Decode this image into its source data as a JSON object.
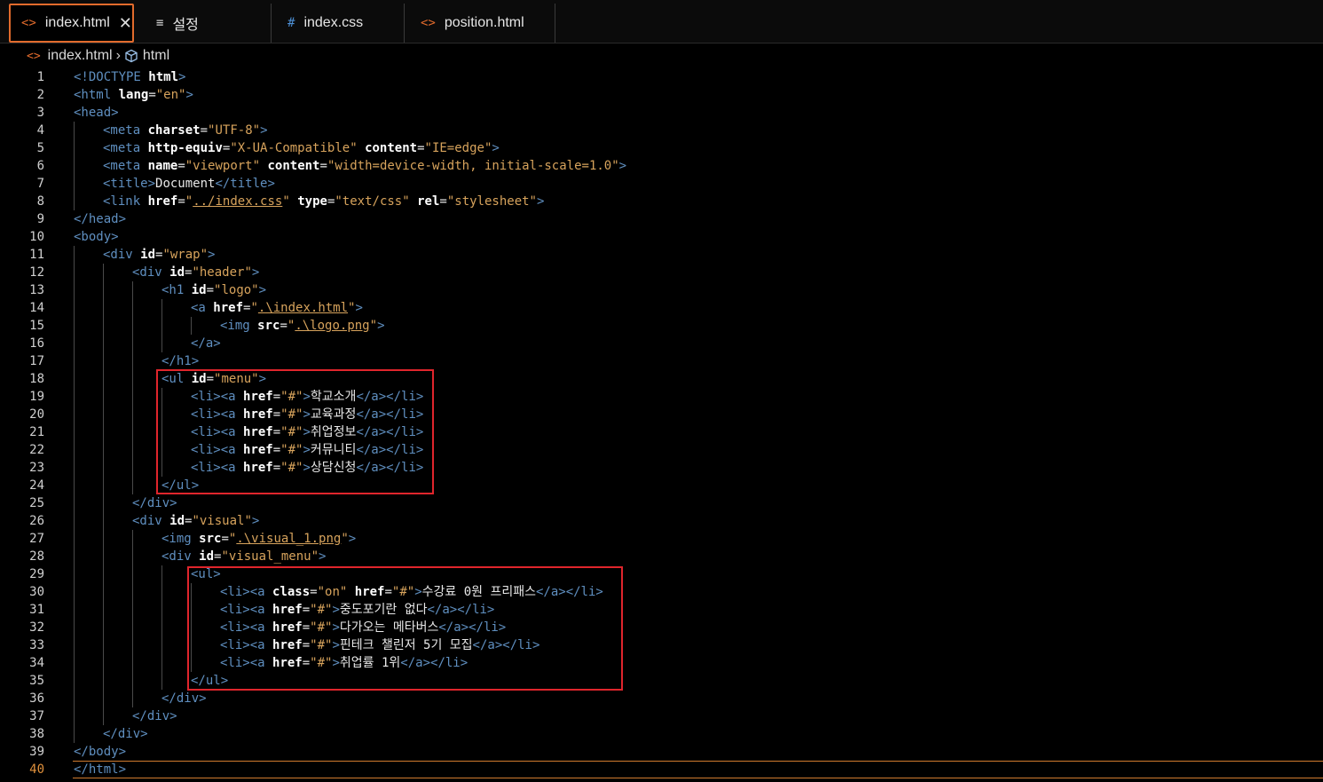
{
  "tabs": [
    {
      "icon": "<>",
      "label": "index.html",
      "active": true
    },
    {
      "icon": "≡",
      "label": "설정"
    },
    {
      "icon": "#",
      "label": "index.css"
    },
    {
      "icon": "<>",
      "label": "position.html"
    }
  ],
  "breadcrumb": {
    "file": "index.html",
    "symbol": "html"
  },
  "colors": {
    "tag": "#5f8fc0",
    "attr": "#ffffff",
    "string": "#d7a35c",
    "accent": "#e26b2c",
    "highlight": "#e0252c"
  },
  "current_line": 40,
  "lines": [
    {
      "n": "1",
      "i": 0,
      "h": "<span class='t'>&lt;!DOCTYPE</span> <span class='a'>html</span><span class='t'>&gt;</span>"
    },
    {
      "n": "2",
      "i": 0,
      "h": "<span class='t'>&lt;html</span> <span class='a'>lang</span><span class='p'>=</span><span class='s'>\"en\"</span><span class='t'>&gt;</span>"
    },
    {
      "n": "3",
      "i": 0,
      "h": "<span class='t'>&lt;head&gt;</span>"
    },
    {
      "n": "4",
      "i": 1,
      "h": "<span class='t'>&lt;meta</span> <span class='a'>charset</span><span class='p'>=</span><span class='s'>\"UTF-8\"</span><span class='t'>&gt;</span>"
    },
    {
      "n": "5",
      "i": 1,
      "h": "<span class='t'>&lt;meta</span> <span class='a'>http-equiv</span><span class='p'>=</span><span class='s'>\"X-UA-Compatible\"</span> <span class='a'>content</span><span class='p'>=</span><span class='s'>\"IE=edge\"</span><span class='t'>&gt;</span>"
    },
    {
      "n": "6",
      "i": 1,
      "h": "<span class='t'>&lt;meta</span> <span class='a'>name</span><span class='p'>=</span><span class='s'>\"viewport\"</span> <span class='a'>content</span><span class='p'>=</span><span class='s'>\"width=device-width, initial-scale=1.0\"</span><span class='t'>&gt;</span>"
    },
    {
      "n": "7",
      "i": 1,
      "h": "<span class='t'>&lt;title&gt;</span><span class='p'>Document</span><span class='t'>&lt;/title&gt;</span>"
    },
    {
      "n": "8",
      "i": 1,
      "h": "<span class='t'>&lt;link</span> <span class='a'>href</span><span class='p'>=</span><span class='s'>\"<span class='u'>../index.css</span>\"</span> <span class='a'>type</span><span class='p'>=</span><span class='s'>\"text/css\"</span> <span class='a'>rel</span><span class='p'>=</span><span class='s'>\"stylesheet\"</span><span class='t'>&gt;</span>"
    },
    {
      "n": "9",
      "i": 0,
      "h": "<span class='t'>&lt;/head&gt;</span>"
    },
    {
      "n": "10",
      "i": 0,
      "h": "<span class='t'>&lt;body&gt;</span>"
    },
    {
      "n": "11",
      "i": 1,
      "h": "<span class='t'>&lt;div</span> <span class='a'>id</span><span class='p'>=</span><span class='s'>\"wrap\"</span><span class='t'>&gt;</span>"
    },
    {
      "n": "12",
      "i": 2,
      "h": "<span class='t'>&lt;div</span> <span class='a'>id</span><span class='p'>=</span><span class='s'>\"header\"</span><span class='t'>&gt;</span>"
    },
    {
      "n": "13",
      "i": 3,
      "h": "<span class='t'>&lt;h1</span> <span class='a'>id</span><span class='p'>=</span><span class='s'>\"logo\"</span><span class='t'>&gt;</span>"
    },
    {
      "n": "14",
      "i": 4,
      "h": "<span class='t'>&lt;a</span> <span class='a'>href</span><span class='p'>=</span><span class='s'>\"<span class='u'>.\\index.html</span>\"</span><span class='t'>&gt;</span>"
    },
    {
      "n": "15",
      "i": 5,
      "h": "<span class='t'>&lt;img</span> <span class='a'>src</span><span class='p'>=</span><span class='s'>\"<span class='u'>.\\logo.png</span>\"</span><span class='t'>&gt;</span>"
    },
    {
      "n": "16",
      "i": 4,
      "h": "<span class='t'>&lt;/a&gt;</span>"
    },
    {
      "n": "17",
      "i": 3,
      "h": "<span class='t'>&lt;/h1&gt;</span>"
    },
    {
      "n": "18",
      "i": 3,
      "h": "<span class='t'>&lt;ul</span> <span class='a'>id</span><span class='p'>=</span><span class='s'>\"menu\"</span><span class='t'>&gt;</span>"
    },
    {
      "n": "19",
      "i": 4,
      "h": "<span class='t'>&lt;li&gt;&lt;a</span> <span class='a'>href</span><span class='p'>=</span><span class='s'>\"#\"</span><span class='t'>&gt;</span><span class='p'>학교소개</span><span class='t'>&lt;/a&gt;&lt;/li&gt;</span>"
    },
    {
      "n": "20",
      "i": 4,
      "h": "<span class='t'>&lt;li&gt;&lt;a</span> <span class='a'>href</span><span class='p'>=</span><span class='s'>\"#\"</span><span class='t'>&gt;</span><span class='p'>교육과정</span><span class='t'>&lt;/a&gt;&lt;/li&gt;</span>"
    },
    {
      "n": "21",
      "i": 4,
      "h": "<span class='t'>&lt;li&gt;&lt;a</span> <span class='a'>href</span><span class='p'>=</span><span class='s'>\"#\"</span><span class='t'>&gt;</span><span class='p'>취업정보</span><span class='t'>&lt;/a&gt;&lt;/li&gt;</span>"
    },
    {
      "n": "22",
      "i": 4,
      "h": "<span class='t'>&lt;li&gt;&lt;a</span> <span class='a'>href</span><span class='p'>=</span><span class='s'>\"#\"</span><span class='t'>&gt;</span><span class='p'>커뮤니티</span><span class='t'>&lt;/a&gt;&lt;/li&gt;</span>"
    },
    {
      "n": "23",
      "i": 4,
      "h": "<span class='t'>&lt;li&gt;&lt;a</span> <span class='a'>href</span><span class='p'>=</span><span class='s'>\"#\"</span><span class='t'>&gt;</span><span class='p'>상담신청</span><span class='t'>&lt;/a&gt;&lt;/li&gt;</span>"
    },
    {
      "n": "24",
      "i": 3,
      "h": "<span class='t'>&lt;/ul&gt;</span>"
    },
    {
      "n": "25",
      "i": 2,
      "h": "<span class='t'>&lt;/div&gt;</span>"
    },
    {
      "n": "26",
      "i": 2,
      "h": "<span class='t'>&lt;div</span> <span class='a'>id</span><span class='p'>=</span><span class='s'>\"visual\"</span><span class='t'>&gt;</span>"
    },
    {
      "n": "27",
      "i": 3,
      "h": "<span class='t'>&lt;img</span> <span class='a'>src</span><span class='p'>=</span><span class='s'>\"<span class='u'>.\\visual_1.png</span>\"</span><span class='t'>&gt;</span>"
    },
    {
      "n": "28",
      "i": 3,
      "h": "<span class='t'>&lt;div</span> <span class='a'>id</span><span class='p'>=</span><span class='s'>\"visual_menu\"</span><span class='t'>&gt;</span>"
    },
    {
      "n": "29",
      "i": 4,
      "h": "<span class='t'>&lt;ul&gt;</span>"
    },
    {
      "n": "30",
      "i": 5,
      "h": "<span class='t'>&lt;li&gt;&lt;a</span> <span class='a'>class</span><span class='p'>=</span><span class='s'>\"on\"</span> <span class='a'>href</span><span class='p'>=</span><span class='s'>\"#\"</span><span class='t'>&gt;</span><span class='p'>수강료 0원 프리패스</span><span class='t'>&lt;/a&gt;&lt;/li&gt;</span>"
    },
    {
      "n": "31",
      "i": 5,
      "h": "<span class='t'>&lt;li&gt;&lt;a</span> <span class='a'>href</span><span class='p'>=</span><span class='s'>\"#\"</span><span class='t'>&gt;</span><span class='p'>중도포기란 없다</span><span class='t'>&lt;/a&gt;&lt;/li&gt;</span>"
    },
    {
      "n": "32",
      "i": 5,
      "h": "<span class='t'>&lt;li&gt;&lt;a</span> <span class='a'>href</span><span class='p'>=</span><span class='s'>\"#\"</span><span class='t'>&gt;</span><span class='p'>다가오는 메타버스</span><span class='t'>&lt;/a&gt;&lt;/li&gt;</span>"
    },
    {
      "n": "33",
      "i": 5,
      "h": "<span class='t'>&lt;li&gt;&lt;a</span> <span class='a'>href</span><span class='p'>=</span><span class='s'>\"#\"</span><span class='t'>&gt;</span><span class='p'>핀테크 챌린저 5기 모집</span><span class='t'>&lt;/a&gt;&lt;/li&gt;</span>"
    },
    {
      "n": "34",
      "i": 5,
      "h": "<span class='t'>&lt;li&gt;&lt;a</span> <span class='a'>href</span><span class='p'>=</span><span class='s'>\"#\"</span><span class='t'>&gt;</span><span class='p'>취업률 1위</span><span class='t'>&lt;/a&gt;&lt;/li&gt;</span>"
    },
    {
      "n": "35",
      "i": 4,
      "h": "<span class='t'>&lt;/ul&gt;</span>"
    },
    {
      "n": "36",
      "i": 3,
      "h": "<span class='t'>&lt;/div&gt;</span>"
    },
    {
      "n": "37",
      "i": 2,
      "h": "<span class='t'>&lt;/div&gt;</span>"
    },
    {
      "n": "38",
      "i": 1,
      "h": "<span class='t'>&lt;/div&gt;</span>"
    },
    {
      "n": "39",
      "i": 0,
      "h": "<span class='t'>&lt;/body&gt;</span>"
    },
    {
      "n": "40",
      "i": 0,
      "h": "<span class='t'>&lt;/html&gt;</span>"
    }
  ]
}
